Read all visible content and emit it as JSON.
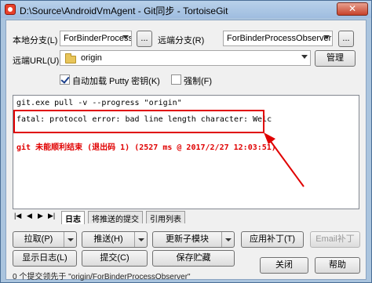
{
  "window": {
    "title": "D:\\Source\\AndroidVmAgent - Git同步 - TortoiseGit",
    "close_label": "✕"
  },
  "local_branch": {
    "label": "本地分支(L)",
    "value": "ForBinderProcessOI",
    "browse_label": "..."
  },
  "remote_branch": {
    "label": "远端分支(R)",
    "value": "ForBinderProcessObserver",
    "browse_label": "..."
  },
  "remote_url": {
    "label": "远端URL(U):",
    "value": "origin",
    "manage_label": "管理"
  },
  "options": {
    "autoload_putty": {
      "label": "自动加载 Putty 密钥(K)",
      "checked": true
    },
    "force": {
      "label": "强制(F)",
      "checked": false
    }
  },
  "log": {
    "lines": [
      "git.exe pull -v --progress \"origin\"",
      "fatal: protocol error: bad line length character: Welc",
      "git 未能顺利结束 (退出码 1) (2527 ms @ 2017/2/27 12:03:51)"
    ]
  },
  "tabs": [
    {
      "label": "日志"
    },
    {
      "label": "将推送的提交"
    },
    {
      "label": "引用列表"
    }
  ],
  "buttons": {
    "pull": "拉取(P)",
    "push": "推送(H)",
    "update_submodule": "更新子模块",
    "apply_patch": "应用补丁(T)",
    "email_patch": "Email补丁",
    "show_log": "显示日志(L)",
    "commit": "提交(C)",
    "stash_save": "保存贮藏",
    "close": "关闭",
    "help": "帮助"
  },
  "status_text": "0 个提交领先于 \"origin/ForBinderProcessObserver\"",
  "colors": {
    "error_red": "#e00000",
    "title_bar": "#b9d1ea"
  }
}
